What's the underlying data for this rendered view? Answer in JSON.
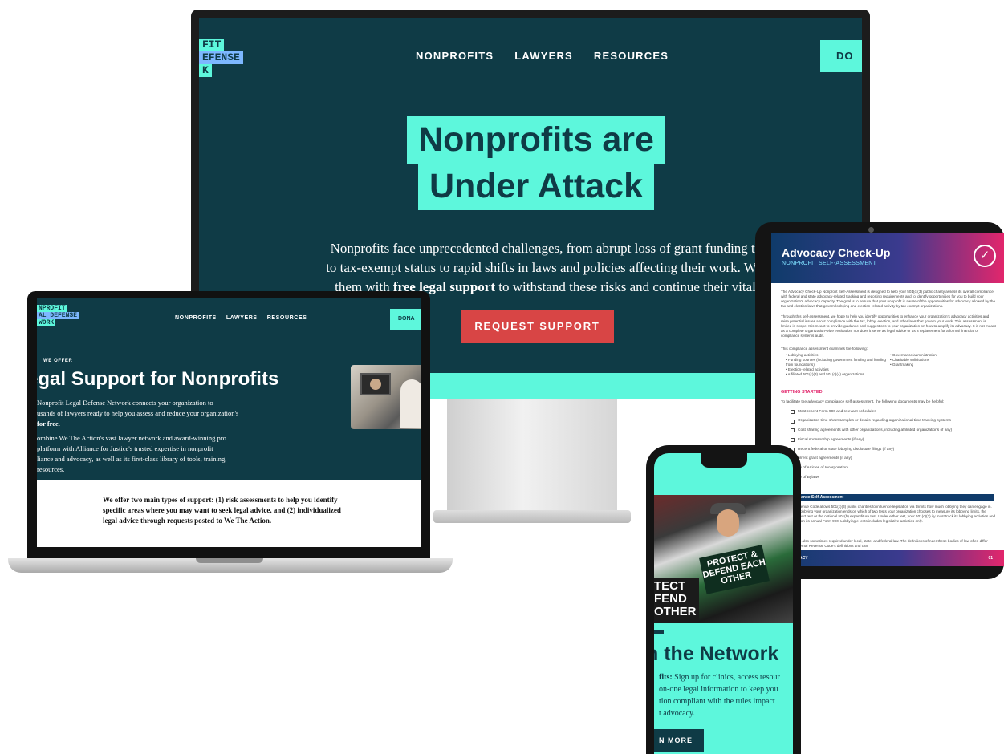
{
  "desktop": {
    "logo_lines": [
      "FIT",
      "EFENSE",
      "K"
    ],
    "nav": [
      "NONPROFITS",
      "LAWYERS",
      "RESOURCES"
    ],
    "donate_label": "DO",
    "headline_line1": "Nonprofits are",
    "headline_line2": "Under Attack",
    "body_line1": "Nonprofits face unprecedented challenges, from abrupt loss of grant funding to thr",
    "body_line2": "to tax-exempt status to rapid shifts in laws and policies affecting their work. We con",
    "body_line3_pre": "them with ",
    "body_line3_bold": "free legal support",
    "body_line3_post": " to withstand these risks and continue their vital wo",
    "cta_label": "REQUEST SUPPORT"
  },
  "laptop": {
    "logo_lines": [
      "NPROFIT",
      "AL DEFENSE",
      "WORK"
    ],
    "nav": [
      "NONPROFITS",
      "LAWYERS",
      "RESOURCES"
    ],
    "donate_label": "DONA",
    "eyebrow": "WE OFFER",
    "title": "egal Support for Nonprofits",
    "p1_line1": "Nonprofit Legal Defense Network connects your organization to",
    "p1_line2": "usands of lawyers ready to help you assess and reduce your organization's",
    "p1_line3_bold": "for free",
    "p1_line3_post": ".",
    "p2_line1": "ombine We The Action's vast lawyer network and award-winning pro",
    "p2_line2": "platform with Alliance for Justice's trusted expertise in nonprofit",
    "p2_line3": "liance and advocacy, as well as its first-class library of tools, training,",
    "p2_line4": "resources.",
    "body_line1": "We offer two main types of support: (1) risk assessments to help you identify",
    "body_line2": "specific areas where you may want to seek legal advice, and (2) individualized",
    "body_line3": "legal advice through requests posted to We The Action."
  },
  "tablet": {
    "title": "Advocacy Check-Up",
    "subtitle": "NONPROFIT SELF-ASSESSMENT",
    "badge_icon": "shield-check-icon",
    "intro1": "The Advocacy Check-Up Nonprofit Self-Assessment is designed to help your 501(c)(3) public charity assess its overall compliance with federal and state advocacy-related tracking and reporting requirements and to identify opportunities for you to build your organization's advocacy capacity. The goal is to ensure that your nonprofit is aware of the opportunities for advocacy allowed by the tax and election laws that govern lobbying and election-related activity by tax-exempt organizations.",
    "intro2": "Through this self-assessment, we hope to help you identify opportunities to enhance your organization's advocacy activities and raise potential issues about compliance with the tax, lobby, election, and other laws that govern your work. This assessment is limited in scope. It is meant to provide guidance and suggestions to your organization on how to amplify its advocacy. It is not meant as a complete organization-wide evaluation, nor does it serve as legal advice or as a replacement for a formal financial or compliance systems audit.",
    "intro3": "This compliance assessment examines the following:",
    "list_left": [
      "Lobbying activities",
      "Funding sources (including government funding and funding from foundations)",
      "Election-related activities",
      "Affiliated 501(c)(3) and 501(c)(4) organizations"
    ],
    "list_right": [
      "Governance/administration",
      "Charitable solicitations",
      "Grantmaking"
    ],
    "getting_started": "GETTING STARTED",
    "docs_intro": "To facilitate the advocacy compliance self-assessment, the following documents may be helpful:",
    "docs": [
      "Most recent Form 990 and relevant schedules",
      "Organization time sheet samples or details regarding organizational time tracking systems",
      "Cost sharing agreements with other organizations, including affiliated organizations (if any)",
      "Fiscal sponsorship agreements (if any)",
      "Recent federal or state lobbying disclosure filings (if any)",
      "urrent grant agreements (if any)",
      "py of Articles of Incorporation",
      "py of Bylaws"
    ],
    "section_bar": "y Compliance Self-Assessment",
    "text2": "Internal Revenue Code allows 501(c)(3) public charities to influence legislation via t limits how much lobbying they can engage in. How much lobbying your organization ends on which of two tests your organization chooses to measure its lobbying limits, the substantial part test or the optional 501(h) expenditure test. Under either test, your 501(c)(3) ity must track its lobbying activities and report them on its annual Form 990. Lobbying e tests includes legislative activities only.",
    "text3": "disclosure is also sometimes required under local, state, and federal law. The definitions of nder these bodies of law often differ from the Internal Revenue Code's definitions and can",
    "footer_brand": "ERADVOCACY",
    "footer_page": "01"
  },
  "phone": {
    "sign1": "PROTECT & DEFEND EACH OTHER",
    "sign2": "TECT FEND OTHER",
    "title": "n the Network",
    "body_bold": "fits:",
    "body_line1": " Sign up for clinics, access resour",
    "body_line2": "on-one legal information to keep you",
    "body_line3": "tion compliant with the rules impact",
    "body_line4": "t advocacy.",
    "button_label": "N MORE"
  },
  "colors": {
    "navy": "#0f3b46",
    "aqua": "#5df7dc",
    "red": "#d84545",
    "pink": "#e2266c"
  }
}
